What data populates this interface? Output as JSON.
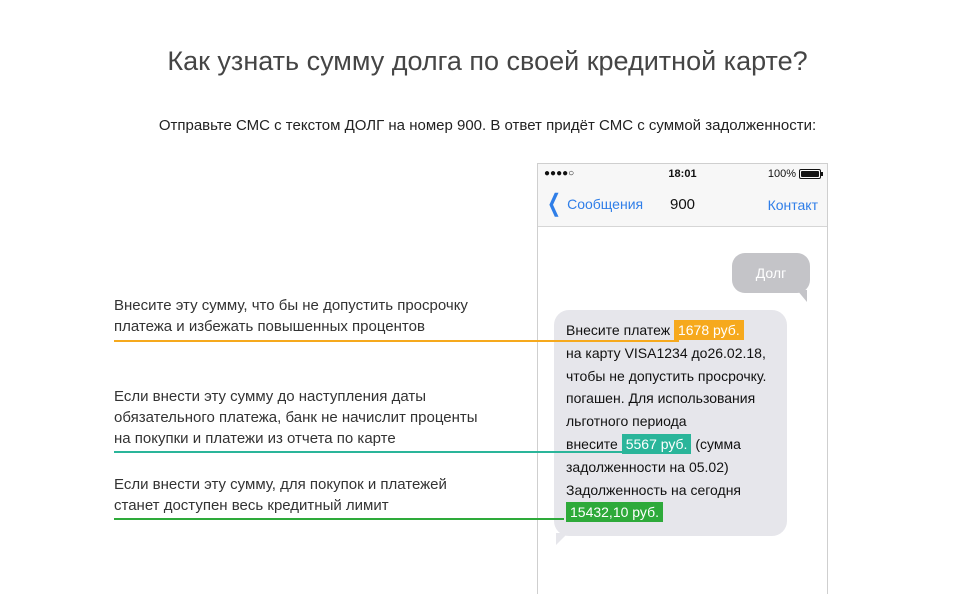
{
  "title": "Как узнать сумму долга по своей кредитной карте?",
  "subtitle": "Отправьте СМС с текстом ДОЛГ на номер 900. В ответ придёт СМС с суммой задолженности:",
  "phone": {
    "status": {
      "signal": "●●●●○",
      "time": "18:01",
      "battery": "100%"
    },
    "nav": {
      "back_label": "Сообщения",
      "title": "900",
      "contact_label": "Контакт"
    },
    "outgoing_message": "Долг",
    "incoming_message": {
      "line1_prefix": "Внесите платеж",
      "amount_min": "1678 руб.",
      "line2": "на карту VISA1234 до26.02.18,",
      "line3": "чтобы не допустить просрочку.",
      "line4": "погашен. Для использования",
      "line5": "льготного периода",
      "line6_prefix": "внесите",
      "amount_grace": "5567 руб.",
      "line6_suffix": "(сумма",
      "line7": "задолженности на 05.02)",
      "line8": "Задолженность на сегодня",
      "amount_total": "15432,10 руб."
    }
  },
  "notes": {
    "note1_line1": "Внесите эту сумму, что бы не допустить просрочку",
    "note1_line2": "платежа и избежать повышенных процентов",
    "note2_line1": "Если внести эту сумму до наступления даты",
    "note2_line2": "обязательного платежа, банк не начислит проценты",
    "note2_line3": "на покупки и платежи из отчета по карте",
    "note3_line1": "Если внести эту сумму, для покупок и платежей",
    "note3_line2": "станет доступен весь кредитный лимит"
  },
  "colors": {
    "orange": "#f6a91d",
    "teal": "#2ab59a",
    "green": "#2eaa3a",
    "ios_blue": "#2f7ee8"
  }
}
